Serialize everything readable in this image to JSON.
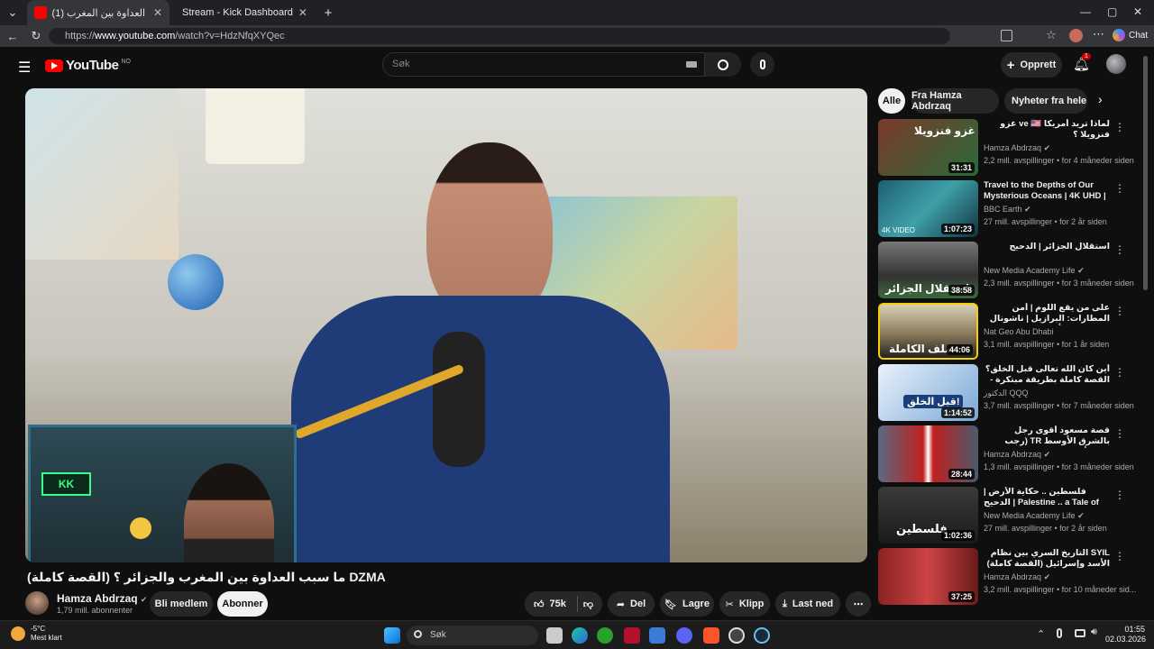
{
  "browser": {
    "tabs": [
      {
        "title": "(1) ما سبب العداوة بين المغرب",
        "active": true
      },
      {
        "title": "Stream - Kick Dashboard",
        "active": false
      }
    ],
    "url_prefix": "https://",
    "url_host": "www.youtube.com",
    "url_path": "/watch?v=HdzNfqXYQec",
    "chat_label": "Chat"
  },
  "youtube": {
    "logo_text": "YouTube",
    "region": "NO",
    "search_placeholder": "Søk",
    "create_label": "Opprett",
    "notif_count": "1",
    "chips": [
      "Alle",
      "Fra Hamza Abdrzaq",
      "Nyheter fra hele verd"
    ],
    "video_title": "ما سبب العداوة بين المغرب والجزائر ؟ (القصة كاملة)",
    "video_title_tag": "DZMA",
    "channel": "Hamza Abdrzaq",
    "subscribers": "1,79 mill. abonnenter",
    "join_label": "Bli medlem",
    "subscribe_label": "Abonner",
    "likes": "75k",
    "share_label": "Del",
    "save_label": "Lagre",
    "clip_label": "Klipp",
    "download_label": "Last ned"
  },
  "recommendations": [
    {
      "title": "لماذا تريد أمريكا ve 🇺🇸 غزو فنزويلا ؟",
      "channel": "Hamza Abdrzaq",
      "meta": "2,2 mill. avspillinger • for 4 måneder siden",
      "duration": "31:31",
      "thumb": "#7a3a2a",
      "overlay": "غزو فنزويلا"
    },
    {
      "title": "Travel to the Depths of Our Mysterious Oceans | 4K UHD | ...",
      "channel": "BBC Earth",
      "meta": "27 mill. avspillinger • for 2 år siden",
      "duration": "1:07:23",
      "thumb": "#2a7f8f",
      "overlay": "4K VIDEO"
    },
    {
      "title": "استقلال الجزائر | الدحيح",
      "channel": "New Media Academy Life",
      "meta": "2,3 mill. avspillinger • for 3 måneder siden",
      "duration": "38:58",
      "thumb": "#5a5a5a",
      "overlay": "استقلال الجزائر"
    },
    {
      "title": "على من يقع اللوم | أمن المطارات: البرازيل | ناشونال جيوغرافيك أبوظبي",
      "channel": "Nat Geo Abu Dhabi",
      "meta": "3,1 mill. avspillinger • for 1 år siden",
      "duration": "44:06",
      "thumb": "#c9a34a",
      "overlay": "ملف الكاملة"
    },
    {
      "title": "أين كان الله تعالى قبل الخلق؟ القصة كاملة بطريقة مبتكرة - دين و علوم",
      "channel": "الدكتور QQQ",
      "meta": "3,7 mill. avspillinger • for 7 måneder siden",
      "duration": "1:14:52",
      "thumb": "#3a6fb0",
      "overlay": "قبل الخلق!"
    },
    {
      "title": "قصة مسعود أقوى رجل بالشرق الأوسط TR (رجب طيب أردوغان)",
      "channel": "Hamza Abdrzaq",
      "meta": "1,3 mill. avspillinger • for 3 måneder siden",
      "duration": "28:44",
      "thumb": "#8a2a2a",
      "overlay": ""
    },
    {
      "title": "فلسطين .. حكاية الأرض | الدحيح | Palestine .. a Tale of Land",
      "channel": "New Media Academy Life",
      "meta": "27 mill. avspillinger • for 2 år siden",
      "duration": "1:02:36",
      "thumb": "#4a4a4a",
      "overlay": "فلسطين"
    },
    {
      "title": "SYIL التاريخ السري بين نظام الأسد وإسرائيل (القصة كاملة)",
      "channel": "Hamza Abdrzaq",
      "meta": "3,2 mill. avspillinger • for 10 måneder sid...",
      "duration": "37:25",
      "thumb": "#9a3a3a",
      "overlay": ""
    }
  ],
  "taskbar": {
    "weather_temp": "-5°C",
    "weather_desc": "Mest klart",
    "search_label": "Søk",
    "time": "01:55",
    "date": "02.03.2026"
  },
  "colors": {
    "yt_red": "#ff0000",
    "bg": "#0f0f0f",
    "chip": "#272727"
  }
}
